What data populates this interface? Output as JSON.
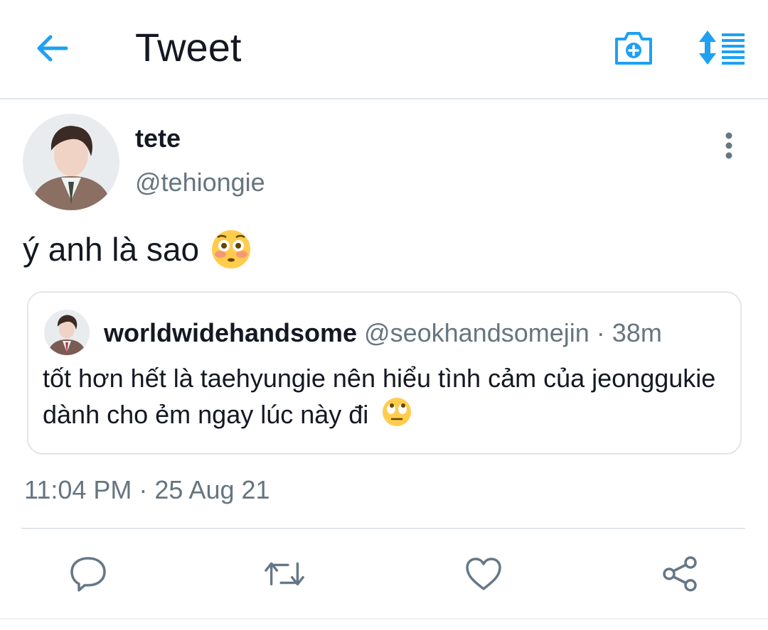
{
  "header": {
    "title": "Tweet",
    "back_icon": "arrow-left-icon",
    "camera_icon": "camera-plus-icon",
    "sort_icon": "sort-lines-icon",
    "accent_color": "#1DA1F2"
  },
  "tweet": {
    "display_name": "tete",
    "handle": "@tehiongie",
    "text": "ý anh là sao",
    "emoji": "😳",
    "timestamp": "11:04 PM · 25 Aug 21"
  },
  "quoted_tweet": {
    "display_name": "worldwidehandsome",
    "handle": "@seokhandsomejin",
    "separator": "·",
    "time": "38m",
    "text": "tốt hơn hết là taehyungie nên hiểu tình cảm của jeonggukie dành cho ẻm ngay lúc này đi",
    "emoji": "🙄"
  },
  "actions": [
    {
      "name": "reply",
      "icon": "speech-bubble-icon"
    },
    {
      "name": "retweet",
      "icon": "retweet-icon"
    },
    {
      "name": "like",
      "icon": "heart-icon"
    },
    {
      "name": "share",
      "icon": "share-icon"
    }
  ],
  "colors": {
    "text_primary": "#141823",
    "text_secondary": "#66757f",
    "divider": "#e1e6ea",
    "icon_gray": "#657786"
  }
}
